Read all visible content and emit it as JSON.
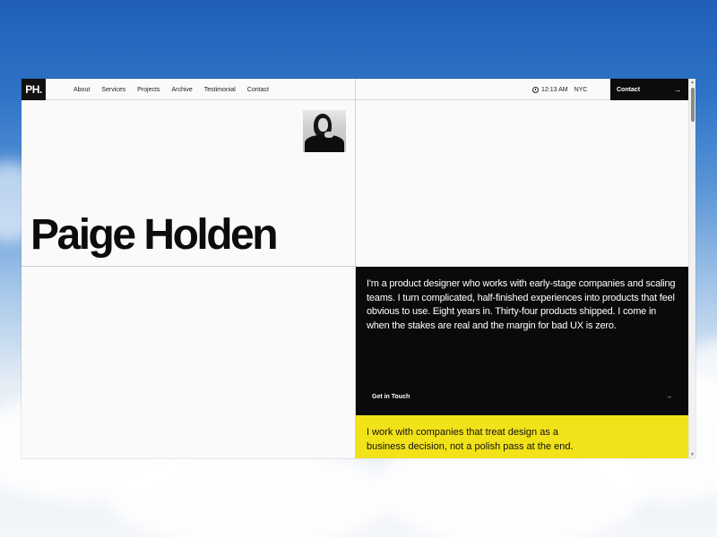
{
  "header": {
    "logo": "PH.",
    "nav": [
      "About",
      "Services",
      "Projects",
      "Archive",
      "Testimonial",
      "Contact"
    ],
    "time": "12:13 AM",
    "city": "NYC",
    "contact_label": "Contact",
    "arrow": "→"
  },
  "hero": {
    "name": "Paige Holden"
  },
  "bio": {
    "text": "I'm a product designer who works with early-stage companies and scaling teams. I turn complicated, half-finished experiences into products that feel obvious to use. Eight years in. Thirty-four products shipped. I come in when the stakes are real and the margin for bad UX is zero.",
    "cta_label": "Get in Touch",
    "cta_arrow": "→"
  },
  "statement": {
    "text": "I work with companies that treat design as a business decision, not a polish pass at the end."
  },
  "colors": {
    "accent_yellow": "#f2e21a",
    "dark": "#0a0a0a"
  },
  "icons": [
    "clock-icon",
    "arrow-right-icon"
  ]
}
